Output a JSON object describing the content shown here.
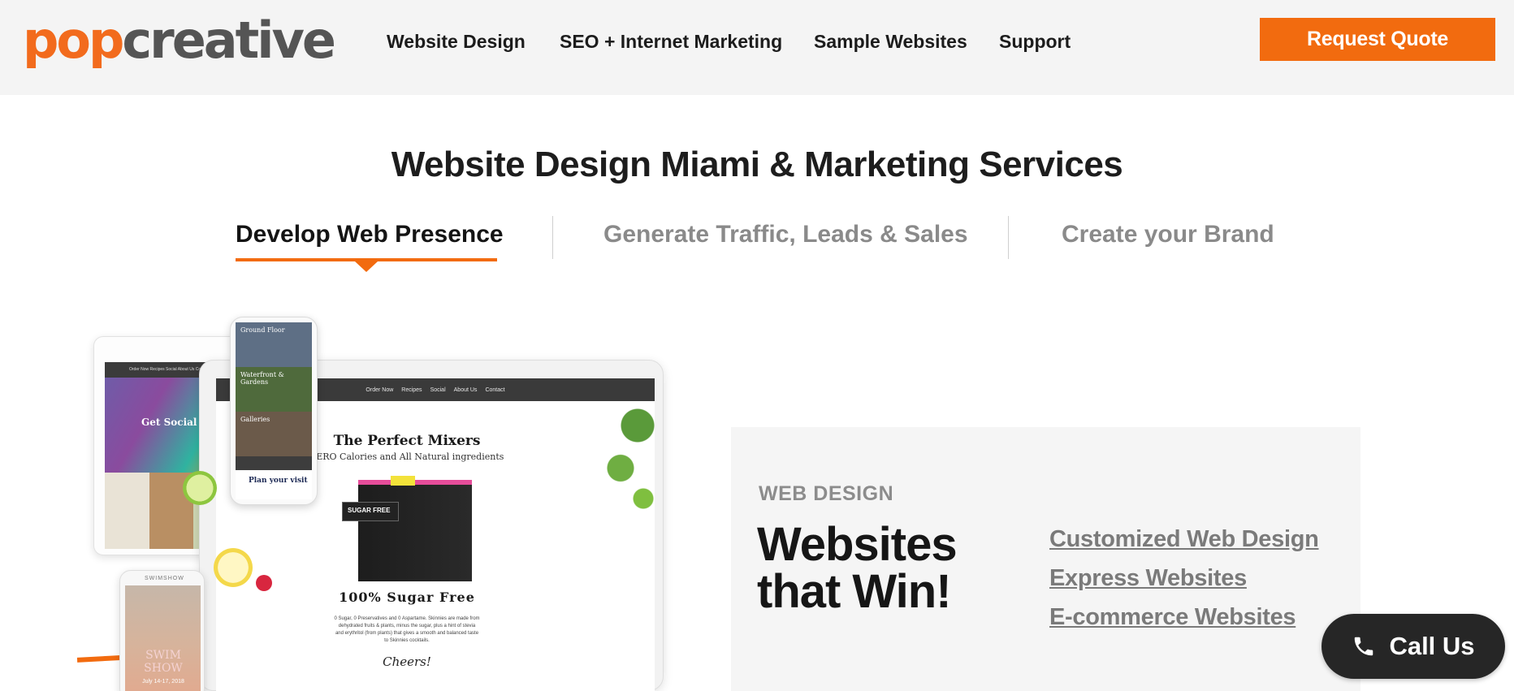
{
  "logo": {
    "part1": "pop",
    "part2": "creative"
  },
  "nav": [
    {
      "label": "Website Design"
    },
    {
      "label": "SEO + Internet Marketing"
    },
    {
      "label": "Sample Websites"
    },
    {
      "label": "Support"
    }
  ],
  "header": {
    "cta_label": "Request Quote"
  },
  "page": {
    "title": "Website Design Miami & Marketing Services"
  },
  "tabs": [
    {
      "label": "Develop Web Presence",
      "active": true
    },
    {
      "label": "Generate Traffic, Leads & Sales",
      "active": false
    },
    {
      "label": "Create your Brand",
      "active": false
    }
  ],
  "mockups": {
    "tablet_nav": "Order Now   Recipes   Social   About Us   Contact",
    "tablet_hero": "Get Social",
    "phone_panels": [
      "Ground Floor",
      "Waterfront & Gardens",
      "Galleries"
    ],
    "phone_cta": "Plan your visit",
    "laptop_nav": [
      "Order Now",
      "Recipes",
      "Social",
      "About Us",
      "Contact"
    ],
    "laptop_title": "The Perfect Mixers",
    "laptop_subtitle": "ZERO Calories and All Natural ingredients",
    "laptop_badge": "SUGAR FREE",
    "laptop_tagline": "100% Sugar Free",
    "laptop_desc": "0 Sugar, 0 Preservatives and 0 Aspartame. Skinnies are made from dehydrated fruits & plants, minus the sugar, plus a hint of stevia and erythritol (from plants) that gives a smooth and balanced taste to Skinnies cocktails.",
    "laptop_signoff": "Cheers!",
    "phone2_brand": "SWIMSHOW",
    "phone2_title": "SWIM SHOW",
    "phone2_date": "July 14-17, 2018"
  },
  "card": {
    "label": "WEB DESIGN",
    "headline_line1": "Websites",
    "headline_line2": "that Win!",
    "links": [
      {
        "label": "Customized Web Design"
      },
      {
        "label": "Express Websites"
      },
      {
        "label": "E-commerce Websites"
      }
    ]
  },
  "call": {
    "label": "Call Us",
    "icon": "phone-icon"
  },
  "colors": {
    "accent": "#f26b0f",
    "logo_gray": "#555555",
    "header_bg": "#f4f4f4",
    "call_bg": "#262626"
  }
}
